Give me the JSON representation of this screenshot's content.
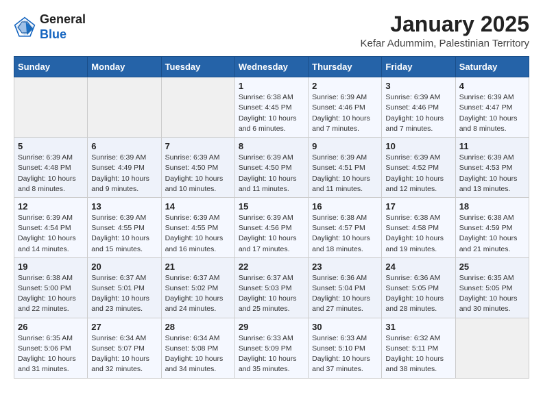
{
  "logo": {
    "general": "General",
    "blue": "Blue"
  },
  "header": {
    "title": "January 2025",
    "subtitle": "Kefar Adummim, Palestinian Territory"
  },
  "weekdays": [
    "Sunday",
    "Monday",
    "Tuesday",
    "Wednesday",
    "Thursday",
    "Friday",
    "Saturday"
  ],
  "weeks": [
    [
      {
        "day": "",
        "info": ""
      },
      {
        "day": "",
        "info": ""
      },
      {
        "day": "",
        "info": ""
      },
      {
        "day": "1",
        "info": "Sunrise: 6:38 AM\nSunset: 4:45 PM\nDaylight: 10 hours\nand 6 minutes."
      },
      {
        "day": "2",
        "info": "Sunrise: 6:39 AM\nSunset: 4:46 PM\nDaylight: 10 hours\nand 7 minutes."
      },
      {
        "day": "3",
        "info": "Sunrise: 6:39 AM\nSunset: 4:46 PM\nDaylight: 10 hours\nand 7 minutes."
      },
      {
        "day": "4",
        "info": "Sunrise: 6:39 AM\nSunset: 4:47 PM\nDaylight: 10 hours\nand 8 minutes."
      }
    ],
    [
      {
        "day": "5",
        "info": "Sunrise: 6:39 AM\nSunset: 4:48 PM\nDaylight: 10 hours\nand 8 minutes."
      },
      {
        "day": "6",
        "info": "Sunrise: 6:39 AM\nSunset: 4:49 PM\nDaylight: 10 hours\nand 9 minutes."
      },
      {
        "day": "7",
        "info": "Sunrise: 6:39 AM\nSunset: 4:50 PM\nDaylight: 10 hours\nand 10 minutes."
      },
      {
        "day": "8",
        "info": "Sunrise: 6:39 AM\nSunset: 4:50 PM\nDaylight: 10 hours\nand 11 minutes."
      },
      {
        "day": "9",
        "info": "Sunrise: 6:39 AM\nSunset: 4:51 PM\nDaylight: 10 hours\nand 11 minutes."
      },
      {
        "day": "10",
        "info": "Sunrise: 6:39 AM\nSunset: 4:52 PM\nDaylight: 10 hours\nand 12 minutes."
      },
      {
        "day": "11",
        "info": "Sunrise: 6:39 AM\nSunset: 4:53 PM\nDaylight: 10 hours\nand 13 minutes."
      }
    ],
    [
      {
        "day": "12",
        "info": "Sunrise: 6:39 AM\nSunset: 4:54 PM\nDaylight: 10 hours\nand 14 minutes."
      },
      {
        "day": "13",
        "info": "Sunrise: 6:39 AM\nSunset: 4:55 PM\nDaylight: 10 hours\nand 15 minutes."
      },
      {
        "day": "14",
        "info": "Sunrise: 6:39 AM\nSunset: 4:55 PM\nDaylight: 10 hours\nand 16 minutes."
      },
      {
        "day": "15",
        "info": "Sunrise: 6:39 AM\nSunset: 4:56 PM\nDaylight: 10 hours\nand 17 minutes."
      },
      {
        "day": "16",
        "info": "Sunrise: 6:38 AM\nSunset: 4:57 PM\nDaylight: 10 hours\nand 18 minutes."
      },
      {
        "day": "17",
        "info": "Sunrise: 6:38 AM\nSunset: 4:58 PM\nDaylight: 10 hours\nand 19 minutes."
      },
      {
        "day": "18",
        "info": "Sunrise: 6:38 AM\nSunset: 4:59 PM\nDaylight: 10 hours\nand 21 minutes."
      }
    ],
    [
      {
        "day": "19",
        "info": "Sunrise: 6:38 AM\nSunset: 5:00 PM\nDaylight: 10 hours\nand 22 minutes."
      },
      {
        "day": "20",
        "info": "Sunrise: 6:37 AM\nSunset: 5:01 PM\nDaylight: 10 hours\nand 23 minutes."
      },
      {
        "day": "21",
        "info": "Sunrise: 6:37 AM\nSunset: 5:02 PM\nDaylight: 10 hours\nand 24 minutes."
      },
      {
        "day": "22",
        "info": "Sunrise: 6:37 AM\nSunset: 5:03 PM\nDaylight: 10 hours\nand 25 minutes."
      },
      {
        "day": "23",
        "info": "Sunrise: 6:36 AM\nSunset: 5:04 PM\nDaylight: 10 hours\nand 27 minutes."
      },
      {
        "day": "24",
        "info": "Sunrise: 6:36 AM\nSunset: 5:05 PM\nDaylight: 10 hours\nand 28 minutes."
      },
      {
        "day": "25",
        "info": "Sunrise: 6:35 AM\nSunset: 5:05 PM\nDaylight: 10 hours\nand 30 minutes."
      }
    ],
    [
      {
        "day": "26",
        "info": "Sunrise: 6:35 AM\nSunset: 5:06 PM\nDaylight: 10 hours\nand 31 minutes."
      },
      {
        "day": "27",
        "info": "Sunrise: 6:34 AM\nSunset: 5:07 PM\nDaylight: 10 hours\nand 32 minutes."
      },
      {
        "day": "28",
        "info": "Sunrise: 6:34 AM\nSunset: 5:08 PM\nDaylight: 10 hours\nand 34 minutes."
      },
      {
        "day": "29",
        "info": "Sunrise: 6:33 AM\nSunset: 5:09 PM\nDaylight: 10 hours\nand 35 minutes."
      },
      {
        "day": "30",
        "info": "Sunrise: 6:33 AM\nSunset: 5:10 PM\nDaylight: 10 hours\nand 37 minutes."
      },
      {
        "day": "31",
        "info": "Sunrise: 6:32 AM\nSunset: 5:11 PM\nDaylight: 10 hours\nand 38 minutes."
      },
      {
        "day": "",
        "info": ""
      }
    ]
  ]
}
